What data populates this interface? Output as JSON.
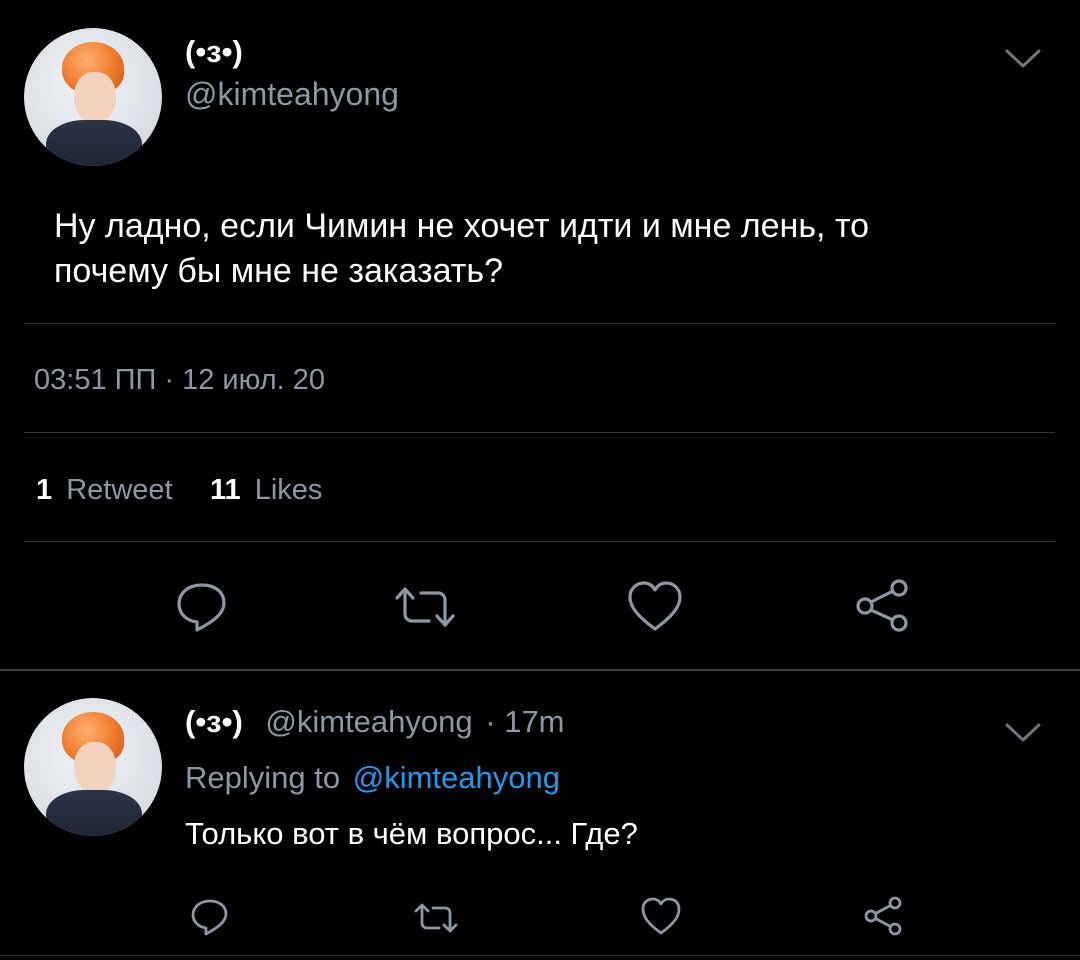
{
  "tweet": {
    "display_name": "(•з•)",
    "handle": "@kimteahyong",
    "text_line1": "Ну ладно, если Чимин не хочет идти и мне лень, то",
    "text_line2": "почему бы мне не заказать?",
    "timestamp": "03:51 ПП · 12 июл. 20",
    "retweet_count": "1",
    "retweet_label": "Retweet",
    "like_count": "11",
    "like_label": "Likes"
  },
  "reply": {
    "display_name": "(•з•)",
    "handle": "@kimteahyong",
    "time_ago": "· 17m",
    "replying_to_label": "Replying to",
    "replying_to_handle": "@kimteahyong",
    "text": "Только вот в чём вопрос... Где?"
  },
  "icons": {
    "menu": "chevron-down-icon",
    "reply": "reply-icon",
    "retweet": "retweet-icon",
    "like": "heart-icon",
    "share": "share-icon"
  },
  "colors": {
    "background": "#000000",
    "text": "#ffffff",
    "muted": "#8b98a5",
    "link": "#1d9bf0",
    "divider": "#2f3336"
  }
}
